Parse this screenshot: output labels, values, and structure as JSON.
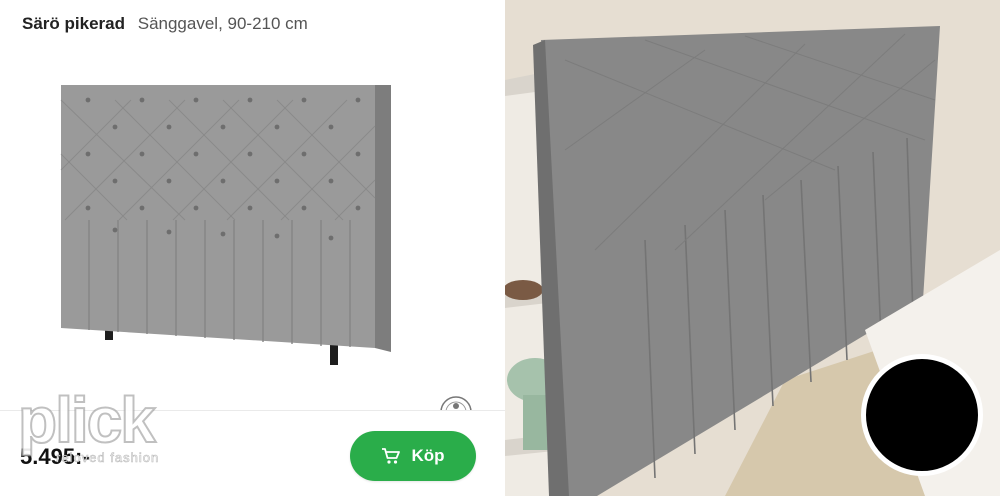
{
  "product": {
    "name": "Särö pikerad",
    "description": "Sänggavel, 90-210 cm",
    "price": "5.495:-"
  },
  "actions": {
    "buy_label": "Köp"
  },
  "watermark": {
    "word": "plick",
    "tagline": "reloved fashion"
  },
  "colors": {
    "buy_button": "#2aad4a",
    "fabric": "#8a8a8a"
  }
}
